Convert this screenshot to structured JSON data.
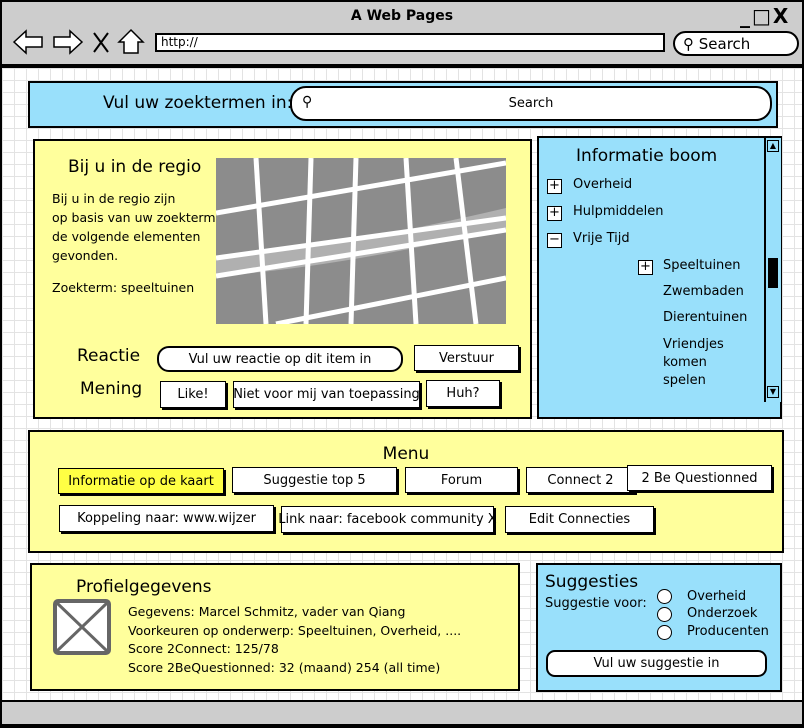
{
  "browser": {
    "title": "A Web Pages",
    "url": "http://",
    "search_label": "Search",
    "window_controls": [
      "minimize",
      "maximize",
      "close"
    ]
  },
  "search_bar": {
    "label": "Vul uw zoektermen in:",
    "placeholder": "Search"
  },
  "region": {
    "title": "Bij u in de regio",
    "description": [
      "Bij u in de regio zijn",
      "op basis van uw zoekterm",
      "de volgende elementen",
      "gevonden."
    ],
    "search_term": "Zoekterm: speeltuinen",
    "reaction_label": "Reactie",
    "reaction_placeholder": "Vul uw reactie op dit item in",
    "send_button": "Verstuur",
    "opinion_label": "Mening",
    "opinion_buttons": [
      "Like!",
      "Niet voor mij van toepassing",
      "Huh?"
    ]
  },
  "tree": {
    "title": "Informatie boom",
    "items": [
      {
        "label": "Overheid",
        "toggle": "+"
      },
      {
        "label": "Hulpmiddelen",
        "toggle": "+"
      },
      {
        "label": "Vrije Tijd",
        "toggle": "−"
      }
    ],
    "children": [
      {
        "label": "Speeltuinen",
        "toggle": "+"
      },
      {
        "label": "Zwembaden"
      },
      {
        "label": "Dierentuinen"
      },
      {
        "label": "Vriendjes komen spelen"
      }
    ]
  },
  "menu": {
    "title": "Menu",
    "row1": [
      "Informatie op de kaart",
      "Suggestie top 5",
      "Forum",
      "Connect 2",
      "2 Be Questionned"
    ],
    "row2": [
      "Koppeling naar: www.wijzer",
      "Link naar: facebook community X",
      "Edit Connecties"
    ],
    "active": "Informatie op de kaart",
    "active_color": "#ffff44"
  },
  "profile": {
    "title": "Profielgegevens",
    "lines": [
      "Gegevens: Marcel Schmitz, vader van Qiang",
      "Voorkeuren op onderwerp: Speeltuinen, Overheid, ....",
      "Score 2Connect: 125/78",
      "Score 2BeQuestionned: 32 (maand) 254 (all time)"
    ]
  },
  "suggestions": {
    "title": "Suggesties",
    "label": "Suggestie voor:",
    "options": [
      "Overheid",
      "Onderzoek",
      "Producenten"
    ],
    "input_placeholder": "Vul uw suggestie in"
  }
}
